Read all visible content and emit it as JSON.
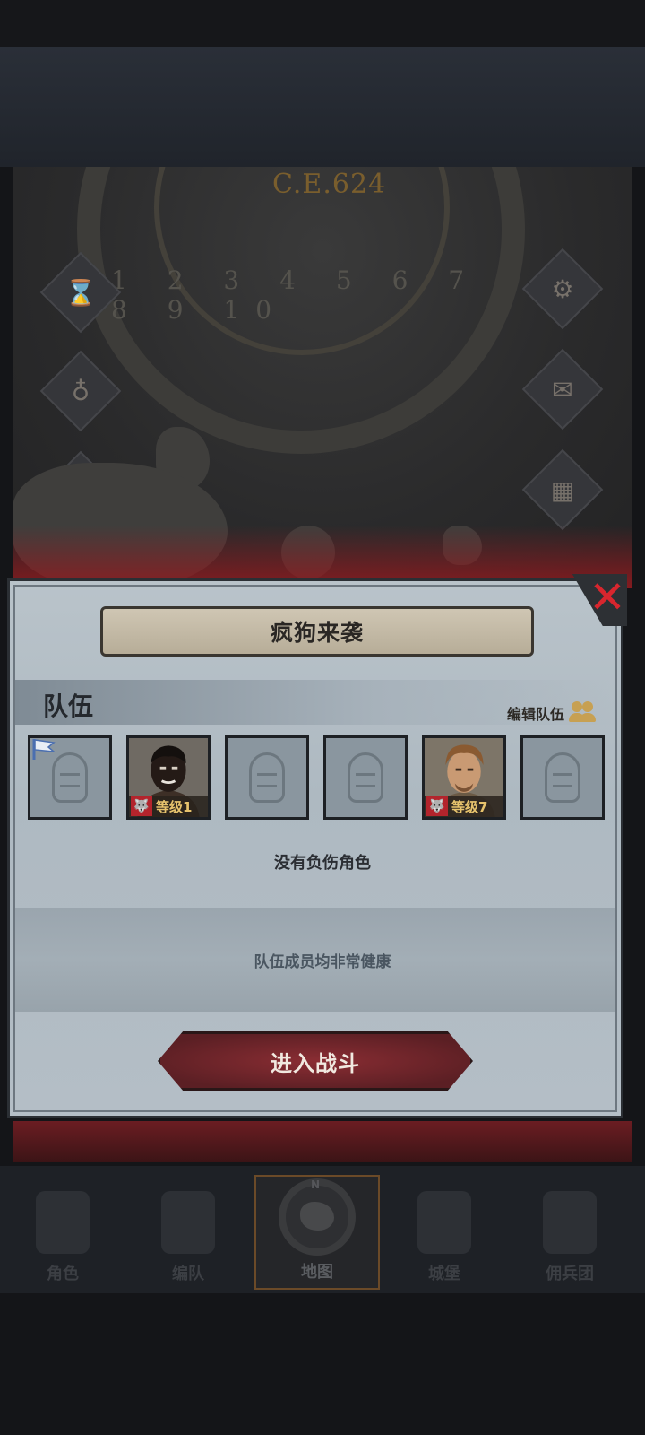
{
  "map": {
    "year": "C.E.624",
    "dial_numbers": "1 2 3 4 5 6 7 8 9 10"
  },
  "dialog": {
    "title": "疯狗来袭",
    "close_icon": "close-x-icon",
    "team_label": "队伍",
    "edit_team_label": "编辑队伍",
    "slots": [
      {
        "state": "empty",
        "flag": true
      },
      {
        "state": "filled",
        "level": "等级1"
      },
      {
        "state": "empty"
      },
      {
        "state": "empty"
      },
      {
        "state": "filled",
        "level": "等级7"
      },
      {
        "state": "empty"
      }
    ],
    "injured_status": "没有负伤角色",
    "health_status": "队伍成员均非常健康",
    "battle_button": "进入战斗"
  },
  "nav": {
    "items": [
      {
        "label": "角色",
        "icon": "knight-icon",
        "active": false
      },
      {
        "label": "编队",
        "icon": "helmet-icon",
        "active": false
      },
      {
        "label": "地图",
        "icon": "compass-map-icon",
        "active": true
      },
      {
        "label": "城堡",
        "icon": "castle-icon",
        "active": false
      },
      {
        "label": "佣兵团",
        "icon": "mercenary-icon",
        "active": false
      }
    ],
    "compass_mark": "N"
  },
  "colors": {
    "close": "#d8262e",
    "level_text": "#e7c36d",
    "battle_button": "#8a2d33",
    "dialog_bg": "#b4bec6"
  }
}
